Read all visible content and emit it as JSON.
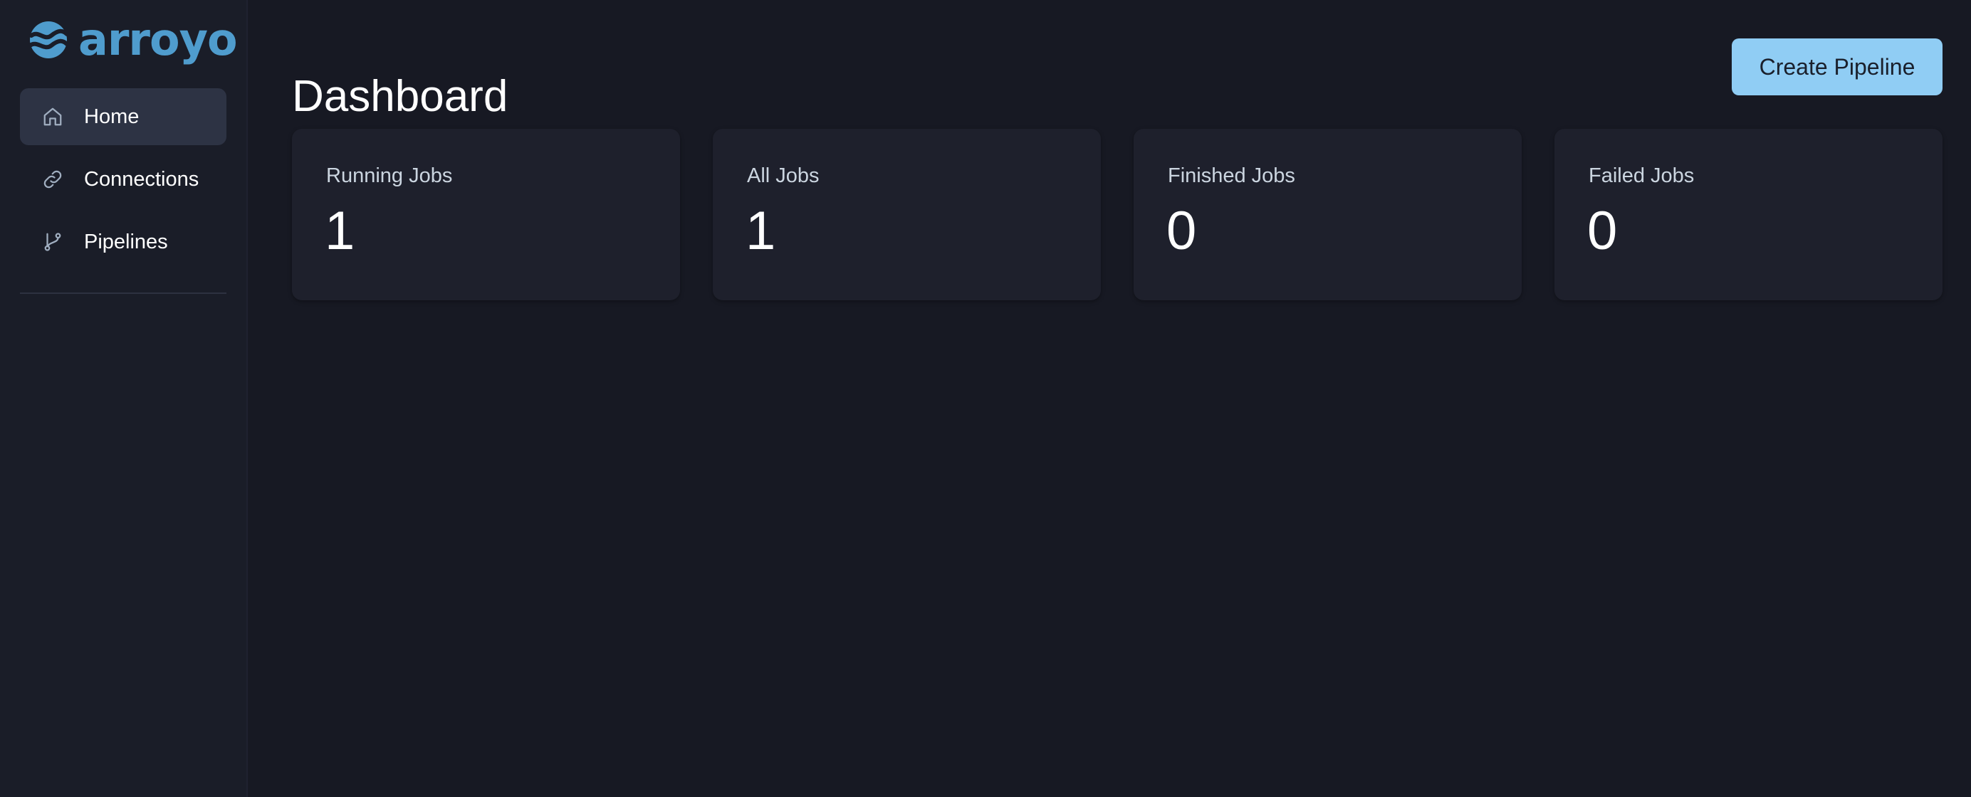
{
  "brand": {
    "name": "arroyo",
    "logo_icon": "wave-logo-icon",
    "color": "#4f9ccd"
  },
  "sidebar": {
    "items": [
      {
        "label": "Home",
        "icon": "home-icon",
        "active": true
      },
      {
        "label": "Connections",
        "icon": "link-icon",
        "active": false
      },
      {
        "label": "Pipelines",
        "icon": "branch-icon",
        "active": false
      }
    ]
  },
  "header": {
    "title": "Dashboard",
    "create_button_label": "Create Pipeline",
    "create_button_color": "#90cdf4"
  },
  "stats": [
    {
      "label": "Running Jobs",
      "value": "1"
    },
    {
      "label": "All Jobs",
      "value": "1"
    },
    {
      "label": "Finished Jobs",
      "value": "0"
    },
    {
      "label": "Failed Jobs",
      "value": "0"
    }
  ],
  "colors": {
    "background": "#171923",
    "sidebar": "#1a1d28",
    "card": "#1e202c",
    "active_nav": "#2d3344"
  }
}
